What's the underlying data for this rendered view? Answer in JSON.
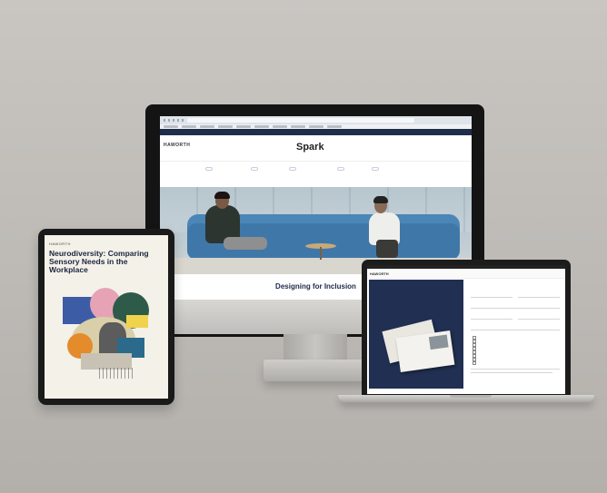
{
  "monitor": {
    "site_bar_left": "",
    "site_bar_mid": "",
    "brand": "HAWORTH",
    "site_title": "Spark",
    "site_subtitle": "",
    "top_nav": "",
    "category_nav": [
      "",
      "",
      "",
      "",
      ""
    ],
    "breadcrumb": "",
    "hero_kicker": "",
    "hero_title": "Designing for Inclusion"
  },
  "tablet": {
    "brand": "HAWORTH",
    "title": "Neurodiversity: Comparing Sensory Needs in the Workplace",
    "date": ""
  },
  "laptop": {
    "brand": "HAWORTH",
    "nav_text": "",
    "form_title": "",
    "book_title": "",
    "form_labels": [
      "",
      "",
      "",
      "",
      "",
      ""
    ],
    "checkbox_labels": [
      "",
      "",
      "",
      "",
      "",
      "",
      "",
      ""
    ],
    "submit_link": ""
  },
  "colors": {
    "background": "#c3c0bc",
    "site_navy": "#1f2d4a",
    "sofa_blue": "#3f78a8",
    "panel_navy": "#213052"
  }
}
